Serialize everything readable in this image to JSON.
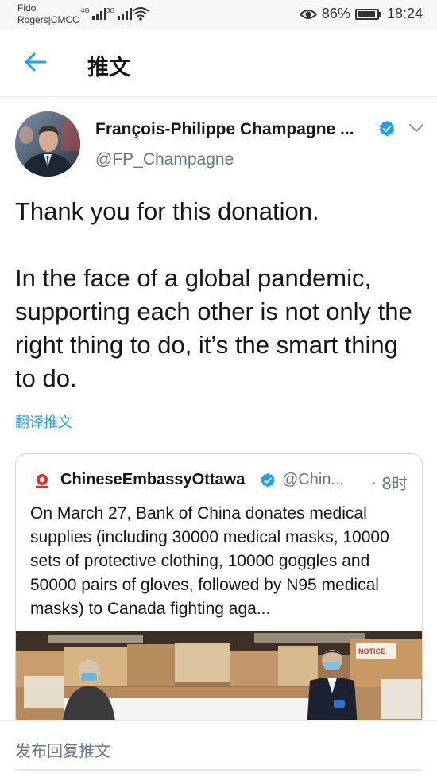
{
  "status_bar": {
    "carrier_line1": "Fido",
    "carrier_line2": "Rogers|CMCC",
    "signal1_label": "4G",
    "signal2_label": "3G",
    "battery_percent": "86%",
    "time": "18:24",
    "icons": [
      "signal-icon",
      "signal-icon",
      "wifi-icon",
      "eye-icon",
      "battery-icon"
    ]
  },
  "header": {
    "title": "推文",
    "back_icon": "arrow-left-icon"
  },
  "tweet": {
    "author_name": "François-Philippe Champagne ...",
    "handle": "@FP_Champagne",
    "paragraphs": [
      "Thank you for this donation.",
      "In the face of a global pandemic, supporting each other is not only the right thing to do, it’s the smart thing to do."
    ],
    "translate_label": "翻译推文"
  },
  "quote": {
    "name": "ChineseEmbassyOttawa",
    "handle": "@Chin...",
    "time": "· 8时",
    "text": "On March 27, Bank of China donates medical supplies (including 30000 medical masks, 10000 sets of protective clothing, 10000 goggles and 50000 pairs of gloves, followed by N95 medical masks) to Canada fighting aga...",
    "photo_sign": "NOTICE"
  },
  "reply": {
    "placeholder": "发布回复推文"
  },
  "colors": {
    "accent": "#1da1f2",
    "text_primary": "#14171a",
    "text_secondary": "#657786",
    "border": "#ccd6dd"
  }
}
